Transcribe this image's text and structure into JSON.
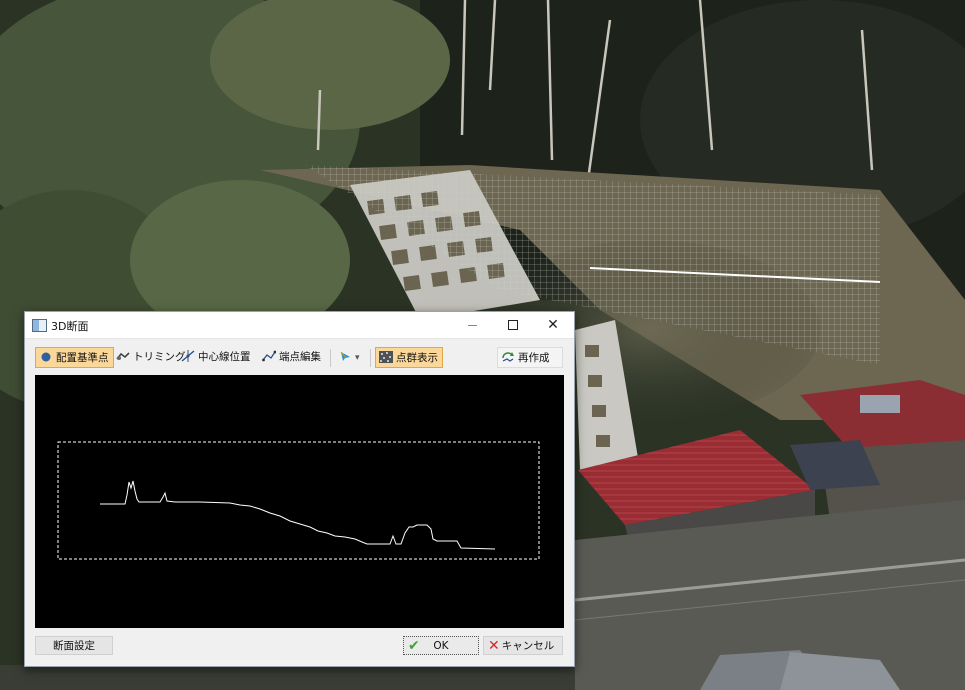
{
  "dialog": {
    "title": "3D断面",
    "window_controls": {
      "close": "✕"
    }
  },
  "toolbar": {
    "items": [
      {
        "label": "配置基準点",
        "icon": "circle-point-icon",
        "active": true
      },
      {
        "label": "トリミング",
        "icon": "trim-icon",
        "active": false
      },
      {
        "label": "中心線位置",
        "icon": "centerline-icon",
        "active": false
      },
      {
        "label": "端点編集",
        "icon": "endpoint-edit-icon",
        "active": false
      },
      {
        "label": "",
        "icon": "pen-dropdown-icon",
        "active": false
      },
      {
        "label": "点群表示",
        "icon": "point-cloud-icon",
        "active": true
      },
      {
        "label": "再作成",
        "icon": "refresh-icon",
        "active": false
      }
    ],
    "dropdown_arrow": "▾"
  },
  "footer": {
    "section_settings_label": "断面設定",
    "ok_label": "OK",
    "cancel_label": "キャンセル"
  },
  "colors": {
    "canvas_background": "#000000",
    "profile_line": "#ffffff",
    "active_button": "#fbd79a",
    "ok_check": "#3da33d",
    "cancel_x": "#d42a2a"
  }
}
